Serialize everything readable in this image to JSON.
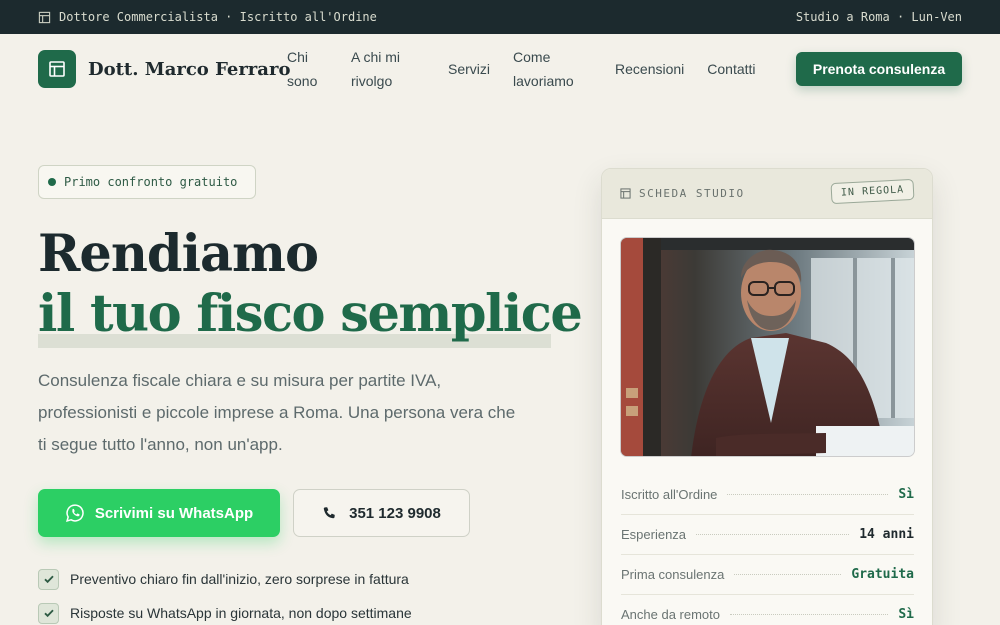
{
  "topbar": {
    "left": "Dottore Commercialista · Iscritto all'Ordine",
    "right": "Studio a Roma · Lun-Ven"
  },
  "brand": {
    "name": "Dott. Marco Ferraro"
  },
  "nav": {
    "items": [
      {
        "label_1": "Chi",
        "label_2": "sono"
      },
      {
        "label_1": "A chi mi",
        "label_2": "rivolgo"
      },
      {
        "label_1": "Servizi"
      },
      {
        "label_1": "Come",
        "label_2": "lavoriamo"
      },
      {
        "label_1": "Recensioni"
      },
      {
        "label_1": "Contatti"
      }
    ],
    "cta": "Prenota consulenza"
  },
  "hero": {
    "pill": "Primo confronto gratuito",
    "title_line1": "Rendiamo",
    "title_line2": "il tuo fisco semplice",
    "lead": "Consulenza fiscale chiara e su misura per partite IVA, professionisti e piccole imprese a Roma. Una persona vera che ti segue tutto l'anno, non un'app.",
    "whatsapp_label": "Scrivimi su WhatsApp",
    "phone_label": "351 123 9908",
    "checks": [
      "Preventivo chiaro fin dall'inizio, zero sorprese in fattura",
      "Risposte su WhatsApp in giornata, non dopo settimane"
    ]
  },
  "card": {
    "title": "SCHEDA STUDIO",
    "stamp": "IN REGOLA",
    "rows": [
      {
        "key": "Iscritto all'Ordine",
        "value": "Sì",
        "color": "#1f6a4a"
      },
      {
        "key": "Esperienza",
        "value": "14 anni",
        "color": "#1f2a2e"
      },
      {
        "key": "Prima consulenza",
        "value": "Gratuita",
        "color": "#1f6a4a"
      },
      {
        "key": "Anche da remoto",
        "value": "Sì",
        "color": "#1f6a4a"
      }
    ]
  },
  "colors": {
    "accent": "#1f6a4a",
    "whatsapp": "#2ccf64",
    "dark": "#1c2a2e"
  }
}
